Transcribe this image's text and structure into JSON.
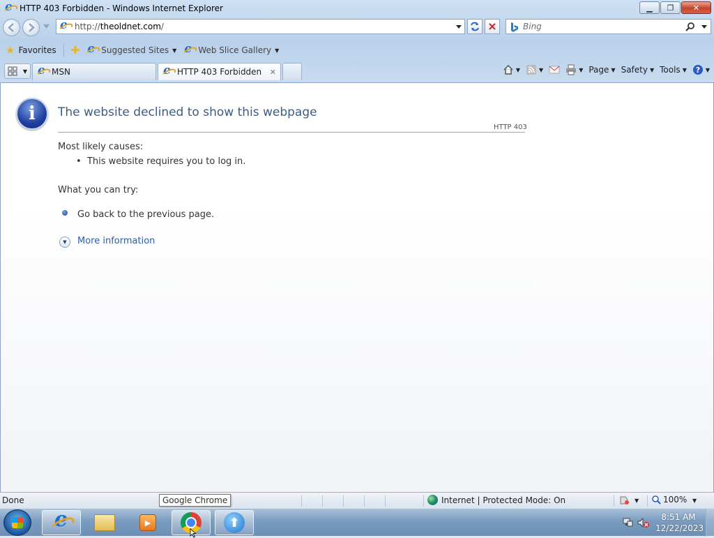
{
  "window": {
    "title": "HTTP 403 Forbidden - Windows Internet Explorer",
    "minimize_glyph": "▁",
    "maximize_glyph": "❐",
    "close_glyph": "✕"
  },
  "address": {
    "prefix": "http://",
    "host": "theoldnet.com",
    "suffix": "/"
  },
  "search": {
    "placeholder": "Bing"
  },
  "favorites_bar": {
    "favorites_label": "Favorites",
    "suggested_sites_label": "Suggested Sites",
    "web_slice_gallery_label": "Web Slice Gallery"
  },
  "tabs": [
    {
      "label": "MSN",
      "active": false
    },
    {
      "label": "HTTP 403 Forbidden",
      "active": true
    }
  ],
  "command_bar": {
    "page_label": "Page",
    "safety_label": "Safety",
    "tools_label": "Tools"
  },
  "content": {
    "heading": "The website declined to show this webpage",
    "http_code": "HTTP 403",
    "causes_label": "Most likely causes:",
    "causes": [
      "This website requires you to log in."
    ],
    "try_label": "What you can try:",
    "go_back": "Go back to the previous page.",
    "more_info": "More information"
  },
  "status_bar": {
    "status": "Done",
    "zone": "Internet | Protected Mode: On",
    "zoom": "100%"
  },
  "tooltip": "Google Chrome",
  "taskbar": {
    "time": "8:51 AM",
    "date": "12/22/2023"
  },
  "colors": {
    "heading": "#3d5c86",
    "link": "#2a5ea8",
    "close_button": "#c7452b"
  }
}
